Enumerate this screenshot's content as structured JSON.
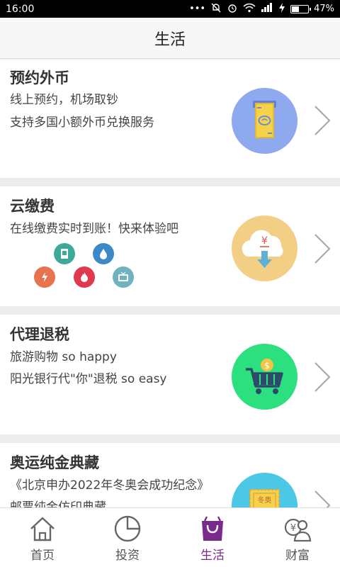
{
  "status": {
    "time": "16:00",
    "signal_dots": "•••",
    "battery": "47%",
    "battery_level": 0.47
  },
  "header": {
    "title": "生活"
  },
  "cards": [
    {
      "title": "预约外币",
      "line1": "线上预约，机场取钞",
      "line2": "支持多国小额外币兑换服务",
      "icon": "currency-note-icon",
      "icon_color": "#8fa9ef"
    },
    {
      "title": "云缴费",
      "line1": "在线缴费实时到账！快来体验吧",
      "icon": "cloud-payment-icon",
      "icon_color": "#f2cf85",
      "mini_icons": [
        {
          "name": "phone-card-icon",
          "color": "#3ea99a"
        },
        {
          "name": "water-drop-icon",
          "color": "#3d89c8"
        },
        {
          "name": "lightning-icon",
          "color": "#e8734f"
        },
        {
          "name": "flame-icon",
          "color": "#e0394f"
        },
        {
          "name": "tv-icon",
          "color": "#6fb3c1"
        }
      ]
    },
    {
      "title": "代理退税",
      "line1": "旅游购物 so happy",
      "line2": "阳光银行代\"你\"退税 so easy",
      "icon": "shopping-cart-icon",
      "icon_color": "#2ce07f"
    },
    {
      "title": "奥运纯金典藏",
      "line1": "《北京申办2022年冬奥会成功纪念》",
      "line2": "邮票纯金仿印典藏",
      "icon": "stamp-icon",
      "icon_color": "#4cc7e6",
      "stamp_text": "冬奥"
    }
  ],
  "tabs": [
    {
      "label": "首页",
      "icon": "home-icon",
      "active": false
    },
    {
      "label": "投资",
      "icon": "pie-chart-icon",
      "active": false
    },
    {
      "label": "生活",
      "icon": "shopping-bag-icon",
      "active": true
    },
    {
      "label": "财富",
      "icon": "wealth-user-icon",
      "active": false
    }
  ],
  "colors": {
    "accent": "#7a2a8c",
    "background": "#ececec"
  }
}
